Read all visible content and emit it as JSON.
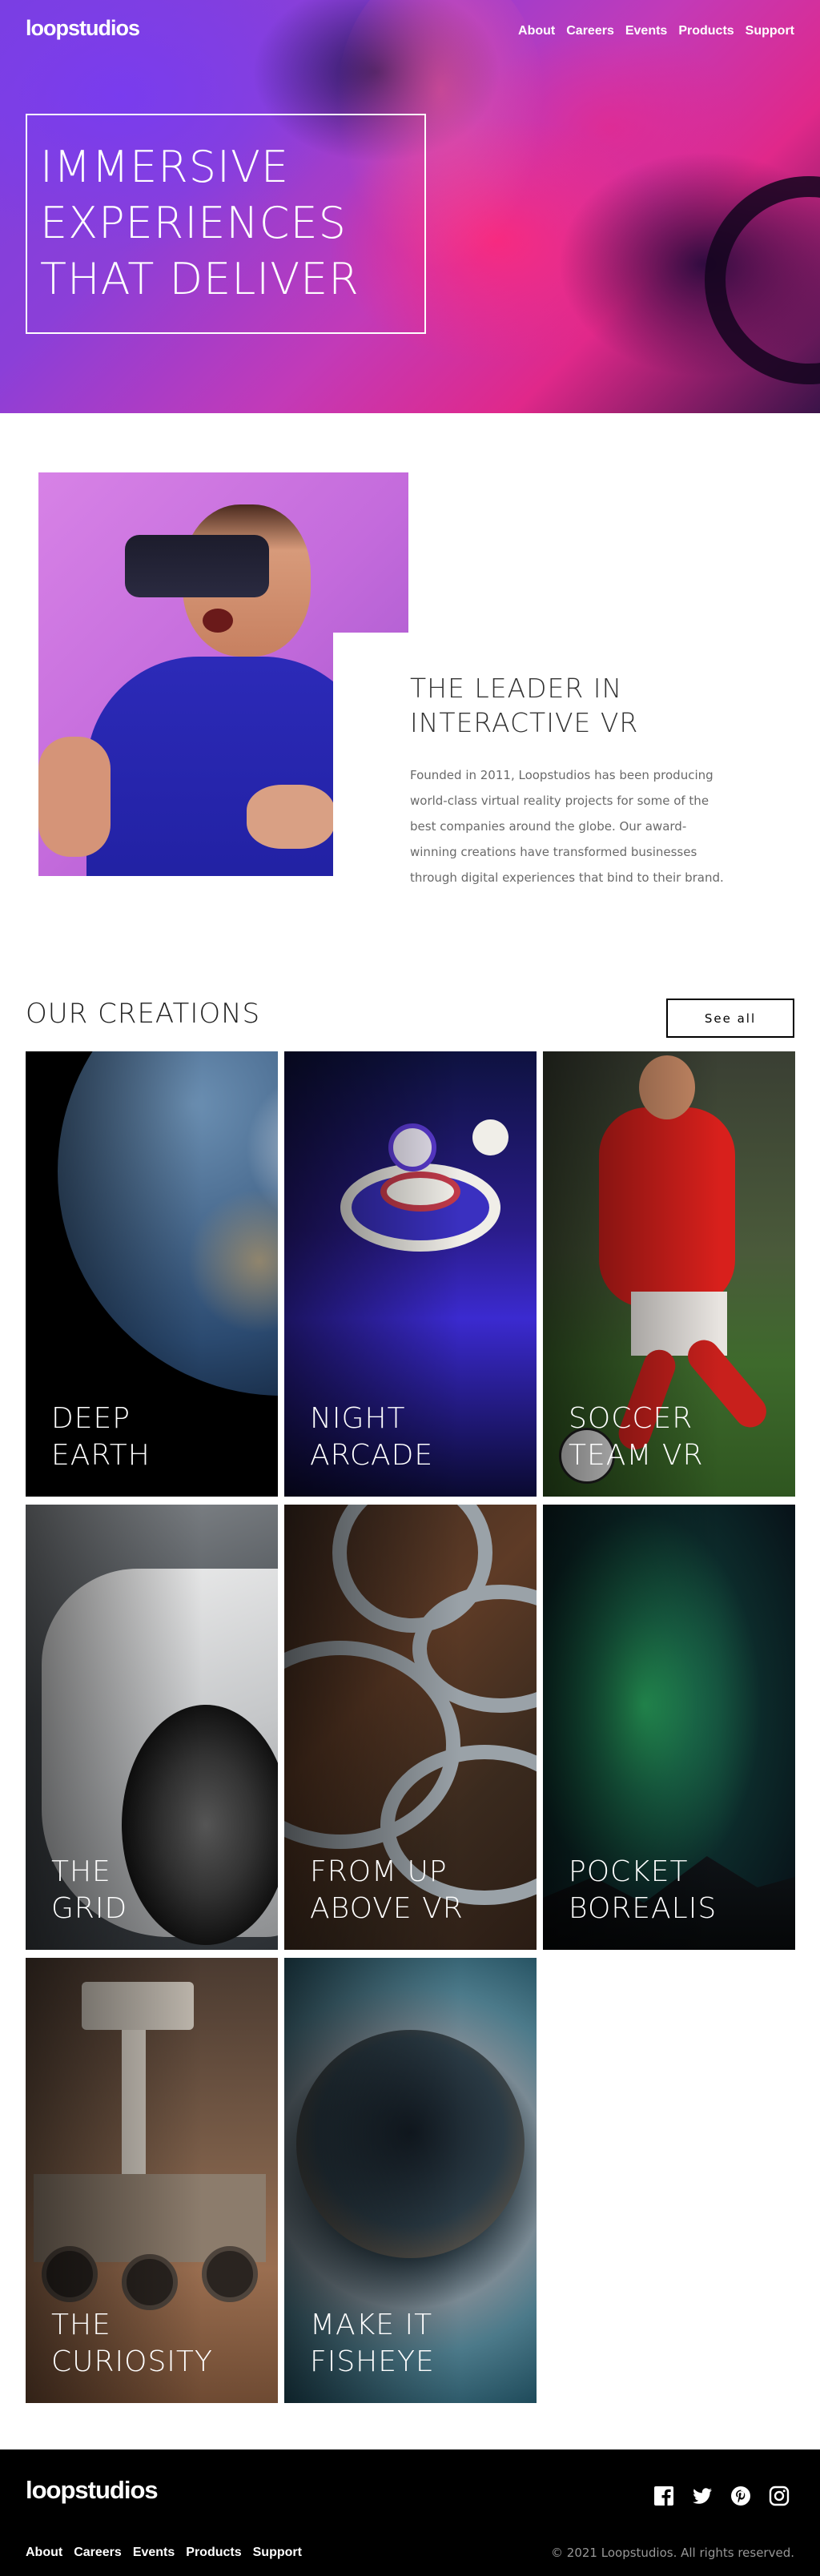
{
  "brand": "loopstudios",
  "nav": [
    "About",
    "Careers",
    "Events",
    "Products",
    "Support"
  ],
  "hero": {
    "title_lines": [
      "IMMERSIVE",
      "EXPERIENCES",
      "THAT DELIVER"
    ]
  },
  "leader": {
    "title_lines": [
      "THE LEADER IN",
      "INTERACTIVE VR"
    ],
    "body": "Founded in 2011, Loopstudios has been producing world-class virtual reality projects for some of the best companies around the globe. Our award-winning creations have transformed businesses through digital experiences that bind to their brand."
  },
  "creations": {
    "title": "OUR CREATIONS",
    "see_all": "See all",
    "cards": [
      {
        "line1": "DEEP",
        "line2": "EARTH"
      },
      {
        "line1": "NIGHT",
        "line2": "ARCADE"
      },
      {
        "line1": "SOCCER",
        "line2": "TEAM VR"
      },
      {
        "line1": "THE",
        "line2": "GRID"
      },
      {
        "line1": "FROM UP",
        "line2": "ABOVE VR"
      },
      {
        "line1": "POCKET",
        "line2": "BOREALIS"
      },
      {
        "line1": "THE",
        "line2": "CURIOSITY"
      },
      {
        "line1": "MAKE IT",
        "line2": "FISHEYE"
      }
    ]
  },
  "footer": {
    "copyright": "© 2021 Loopstudios. All rights reserved.",
    "socials": [
      "facebook-icon",
      "twitter-icon",
      "pinterest-icon",
      "instagram-icon"
    ]
  }
}
